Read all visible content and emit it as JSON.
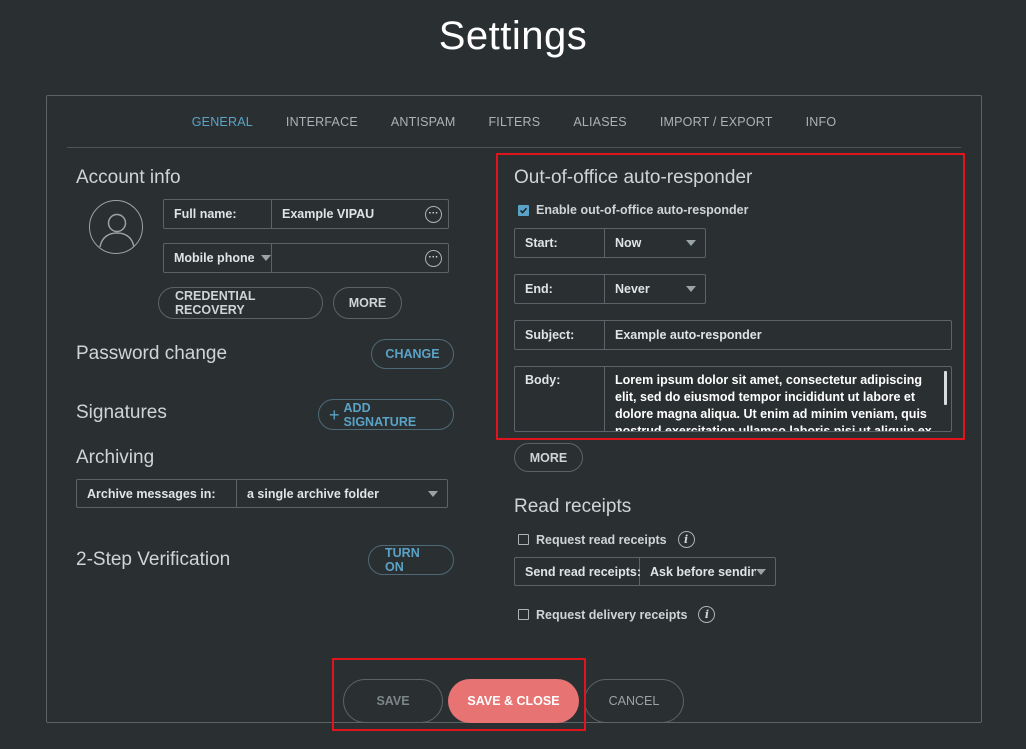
{
  "page_title": "Settings",
  "tabs": [
    {
      "label": "GENERAL"
    },
    {
      "label": "INTERFACE"
    },
    {
      "label": "ANTISPAM"
    },
    {
      "label": "FILTERS"
    },
    {
      "label": "ALIASES"
    },
    {
      "label": "IMPORT / EXPORT"
    },
    {
      "label": "INFO"
    }
  ],
  "account": {
    "title": "Account info",
    "full_name_label": "Full name:",
    "full_name_value": "Example VIPAU",
    "phone_label": "Mobile phone",
    "phone_value": "",
    "credential_recovery": "CREDENTIAL RECOVERY",
    "more": "MORE"
  },
  "password": {
    "title": "Password change",
    "change": "CHANGE"
  },
  "signatures": {
    "title": "Signatures",
    "add": "ADD SIGNATURE"
  },
  "archiving": {
    "title": "Archiving",
    "label": "Archive messages in:",
    "value": "a single archive folder"
  },
  "twostep": {
    "title": "2-Step Verification",
    "turn_on": "TURN ON"
  },
  "ooo": {
    "title": "Out-of-office auto-responder",
    "enable_label": "Enable out-of-office auto-responder",
    "enabled": true,
    "start_label": "Start:",
    "start_value": "Now",
    "end_label": "End:",
    "end_value": "Never",
    "subject_label": "Subject:",
    "subject_value": "Example auto-responder",
    "body_label": "Body:",
    "body_value": "Lorem ipsum dolor sit amet, consectetur adipiscing elit, sed do eiusmod tempor incididunt ut labore et dolore magna aliqua. Ut enim ad minim veniam, quis nostrud exercitation ullamco laboris nisi ut aliquip ex ea commodo",
    "more": "MORE"
  },
  "read_receipts": {
    "title": "Read receipts",
    "request_label": "Request read receipts",
    "send_label": "Send read receipts:",
    "send_value": "Ask before sending",
    "delivery_label": "Request delivery receipts"
  },
  "footer": {
    "save": "SAVE",
    "save_close": "SAVE & CLOSE",
    "cancel": "CANCEL"
  },
  "colors": {
    "accent": "#5ba2c7",
    "primary_button": "#e87373",
    "highlight": "#e0141c",
    "background": "#2a3031"
  }
}
